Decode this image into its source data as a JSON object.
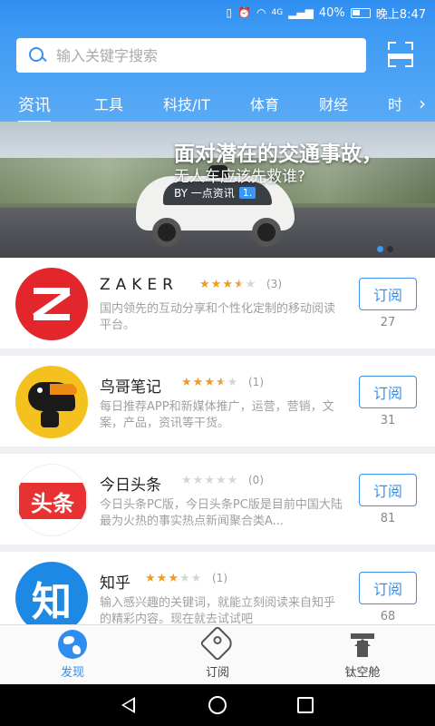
{
  "status_bar": {
    "icons": [
      "vibrate-icon",
      "alarm-icon",
      "wifi-icon",
      "signal-icon"
    ],
    "network": "4G",
    "battery": "40%",
    "time": "晚上8:47"
  },
  "search": {
    "placeholder": "输入关键字搜索"
  },
  "tabs": [
    {
      "label": "资讯",
      "active": true
    },
    {
      "label": "工具"
    },
    {
      "label": "科技/IT"
    },
    {
      "label": "体育"
    },
    {
      "label": "财经"
    },
    {
      "label": "时"
    }
  ],
  "banner": {
    "headline": "面对潜在的交通事故，",
    "subheadline": "无人车应该先救谁?",
    "source": "BY 一点资讯",
    "source_badge": "1."
  },
  "items": [
    {
      "name": "ZAKER",
      "rating": 3.5,
      "count": "(3)",
      "desc": "国内领先的互动分享和个性化定制的移动阅读平台。",
      "button": "订阅",
      "subs": "27"
    },
    {
      "name": "鸟哥笔记",
      "rating": 3.5,
      "count": "(1)",
      "desc": "每日推荐APP和新媒体推广，运营，营销，文案，产品，资讯等干货。",
      "button": "订阅",
      "subs": "31"
    },
    {
      "name": "今日头条",
      "rating": 0,
      "count": "(0)",
      "desc": "今日头条PC版，今日头条PC版是目前中国大陆最为火热的事实热点新闻聚合类A...",
      "button": "订阅",
      "subs": "81",
      "logo_text": "头条"
    },
    {
      "name": "知乎",
      "rating": 3,
      "count": "(1)",
      "desc": "输入感兴趣的关键词，就能立刻阅读来自知乎的精彩内容。现在就去试试吧",
      "button": "订阅",
      "subs": "68",
      "logo_text": "知"
    }
  ],
  "bottom_nav": [
    {
      "label": "发现",
      "icon": "globe-icon",
      "active": true
    },
    {
      "label": "订阅",
      "icon": "tag-icon"
    },
    {
      "label": "钛空舱",
      "icon": "capsule-icon"
    }
  ],
  "colors": {
    "accent": "#2f8df0",
    "star": "#f29b24",
    "zaker_red": "#e3262b"
  }
}
